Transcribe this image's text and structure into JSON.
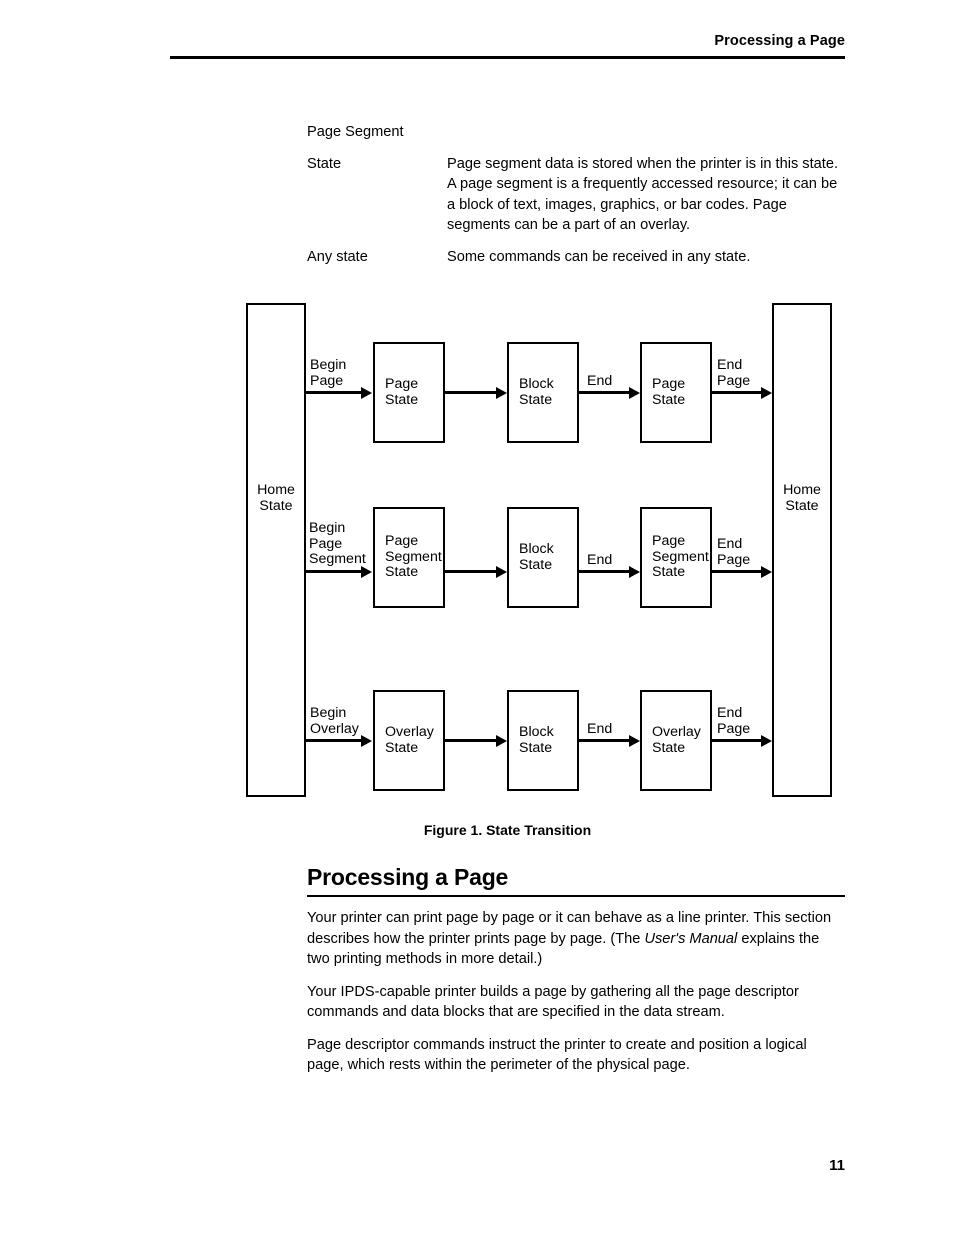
{
  "header": {
    "title": "Processing a Page"
  },
  "definitions": {
    "standalone_term": "Page Segment",
    "rows": [
      {
        "term": "State",
        "description": "Page segment data is stored when the printer is in this state. A page segment is a frequently accessed resource; it can be a block of text, images, graphics, or bar codes. Page segments can be a part of an overlay."
      },
      {
        "term": "Any state",
        "description": "Some commands can be received in any state."
      }
    ]
  },
  "figure": {
    "caption": "Figure 1. State Transition",
    "left_bar_label": "Home\nState",
    "right_bar_label": "Home\nState",
    "rows": [
      {
        "entry_label": "Begin\nPage",
        "boxes": [
          "Page\nState",
          "Block\nState",
          "Page\nState"
        ],
        "mid_label": "End",
        "exit_label": "End\nPage"
      },
      {
        "entry_label": "Begin\nPage\nSegment",
        "boxes": [
          "Page\nSegment\nState",
          "Block\nState",
          "Page\nSegment\nState"
        ],
        "mid_label": "End",
        "exit_label": "End\nPage"
      },
      {
        "entry_label": "Begin\nOverlay",
        "boxes": [
          "Overlay\nState",
          "Block\nState",
          "Overlay\nState"
        ],
        "mid_label": "End",
        "exit_label": "End\nPage"
      }
    ]
  },
  "section": {
    "heading": "Processing a Page",
    "paragraphs": [
      {
        "before": "Your printer can print page by page or it can behave as a line printer. This section describes how the printer prints page by page. (The ",
        "italic": "User's Manual",
        "after": " explains the two printing methods in more detail.)"
      },
      {
        "before": "Your IPDS-capable printer builds a page by gathering all the page descriptor commands and data blocks that are specified in the data stream.",
        "italic": "",
        "after": ""
      },
      {
        "before": "Page descriptor commands instruct the printer to create and position a logical page, which rests within the perimeter of the physical page.",
        "italic": "",
        "after": ""
      }
    ]
  },
  "folio": {
    "page_number": "11"
  },
  "colors": {
    "ink": "#000000",
    "paper": "#ffffff"
  }
}
